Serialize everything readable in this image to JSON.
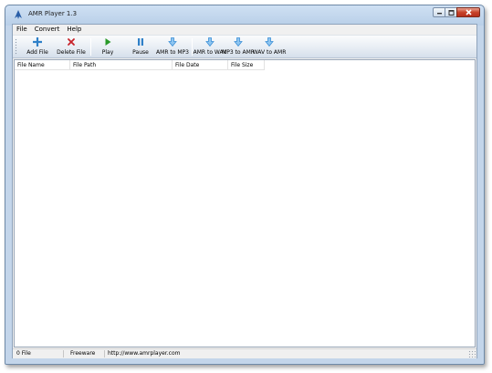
{
  "window": {
    "title": "AMR Player 1.3",
    "app_icon": "amr-player-logo-icon",
    "controls": [
      "minimize-icon",
      "maximize-icon",
      "close-icon"
    ]
  },
  "menu": [
    {
      "label": "File"
    },
    {
      "label": "Convert"
    },
    {
      "label": "Help"
    }
  ],
  "toolbar": {
    "add_file": {
      "label": "Add File",
      "icon": "plus-icon",
      "color": "#2f80c8"
    },
    "delete_file": {
      "label": "Delete File",
      "icon": "x-icon",
      "color": "#c8222a"
    },
    "play": {
      "label": "Play",
      "icon": "play-icon",
      "color": "#2a9a2a"
    },
    "pause": {
      "label": "Pause",
      "icon": "pause-icon",
      "color": "#2f80c8"
    },
    "amr_to_mp3": {
      "label": "AMR to MP3",
      "icon": "convert-arrow-icon",
      "color": "#3b8fd6"
    },
    "amr_to_wav": {
      "label": "AMR to WAV",
      "icon": "convert-arrow-icon",
      "color": "#3b8fd6"
    },
    "mp3_to_amr": {
      "label": "MP3 to AMR",
      "icon": "convert-arrow-icon",
      "color": "#3b8fd6"
    },
    "wav_to_amr": {
      "label": "WAV to AMR",
      "icon": "convert-arrow-icon",
      "color": "#3b8fd6"
    }
  },
  "file_list": {
    "columns": [
      "File Name",
      "File Path",
      "File Date",
      "File Size"
    ],
    "rows": []
  },
  "status": {
    "count": "0 File",
    "license": "Freeware",
    "url": "http://www.amrplayer.com"
  }
}
